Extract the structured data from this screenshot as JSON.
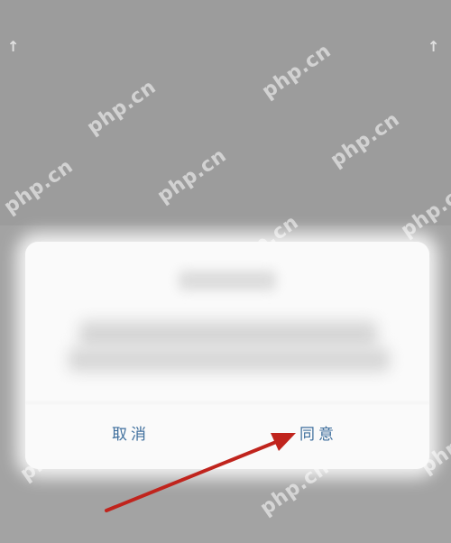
{
  "dialog": {
    "cancel_label": "取消",
    "agree_label": "同意"
  },
  "watermarks": [
    "php.cn"
  ],
  "colors": {
    "backdrop": "#9c9c9c",
    "dialog_bg": "#fafafa",
    "button_text": "#3f6f9d",
    "annotation_arrow": "#c0241d"
  },
  "icons": {
    "annotation": "red-arrow-icon"
  }
}
